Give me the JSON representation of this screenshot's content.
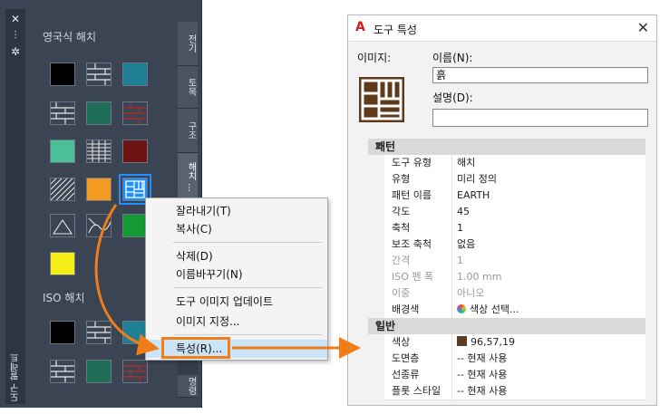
{
  "palette": {
    "strip_icons": [
      "close-icon",
      "pin-icon",
      "settings-icon"
    ],
    "strip_glyphs": [
      "✕",
      "⫶",
      "✲"
    ],
    "vertical_label": "도구 팔레트",
    "groups": [
      {
        "title": "영국식 해치"
      },
      {
        "title": "ISO 해치"
      }
    ],
    "swatch_colors": {
      "black": "#000000",
      "teal": "#1f7f94",
      "dark_green": "#1e6e58",
      "maroon": "#6b1212",
      "mint": "#4cbf99",
      "orange": "#f39a22",
      "green": "#129a34",
      "yellow": "#f6ee17",
      "selected": "#1e90ff"
    },
    "tabs": [
      "전기",
      "토목",
      "구조",
      "해치 ..."
    ],
    "bottom_tab": "명령"
  },
  "context_menu": {
    "items": [
      {
        "label": "잘라내기(T)"
      },
      {
        "label": "복사(C)"
      },
      {
        "label": "삭제(D)"
      },
      {
        "label": "이름바꾸기(N)"
      },
      {
        "label": "도구 이미지 업데이트"
      },
      {
        "label": "이미지 지정..."
      },
      {
        "label": "특성(R)..."
      }
    ],
    "highlight_color": "#f07d1a"
  },
  "props": {
    "title": "도구 특성",
    "image_label": "이미지:",
    "name_label": "이름(N):",
    "name_value": "흙",
    "desc_label": "설명(D):",
    "desc_value": "",
    "pattern_section": "패턴",
    "pattern_rows": [
      {
        "k": "도구 유형",
        "v": "해치"
      },
      {
        "k": "유형",
        "v": "미리 정의"
      },
      {
        "k": "패턴 이름",
        "v": "EARTH"
      },
      {
        "k": "각도",
        "v": "45"
      },
      {
        "k": "축척",
        "v": "1"
      },
      {
        "k": "보조 축척",
        "v": "없음"
      },
      {
        "k": "간격",
        "v": "1"
      },
      {
        "k": "ISO 펜 폭",
        "v": "1.00 mm"
      },
      {
        "k": "이중",
        "v": "아니오"
      },
      {
        "k": "배경색",
        "v": "색상 선택..."
      }
    ],
    "general_section": "일반",
    "general_rows": [
      {
        "k": "색상",
        "v": "96,57,19"
      },
      {
        "k": "도면층",
        "v": "-- 현재 사용"
      },
      {
        "k": "선종류",
        "v": "-- 현재 사용"
      },
      {
        "k": "플롯 스타일",
        "v": "-- 현재 사용"
      }
    ],
    "earth_color": "#60391a"
  }
}
